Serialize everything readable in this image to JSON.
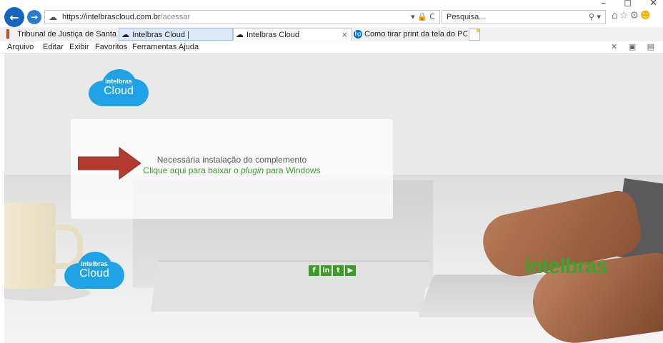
{
  "window": {
    "minimize": "–",
    "maximize": "◻",
    "close": "✕"
  },
  "address_bar": {
    "url_host": "https://intelbrascloud.com.br",
    "url_path": "/acessar",
    "tools": "▾ 🔒 C",
    "search_placeholder": "Pesquisa...",
    "search_icon": "⚲ ▾"
  },
  "tabs": [
    {
      "label": "Tribunal de Justiça de Santa Ca...",
      "icon": "flag-icon"
    },
    {
      "label": "Intelbras Cloud |",
      "icon": "cloud-icon"
    },
    {
      "label": "Intelbras Cloud",
      "icon": "cloud-icon",
      "close": "×",
      "active": true
    },
    {
      "label": "Como tirar print da tela do PC ...",
      "icon": "hp-icon",
      "icon_text": "hp"
    }
  ],
  "menu": [
    "Arquivo",
    "Editar",
    "Exibir",
    "Favoritos",
    "Ferramentas",
    "Ajuda"
  ],
  "menu_right": "✕ ▣ ▤",
  "logo": {
    "line1": "intelbras",
    "line2": "Cloud"
  },
  "plugin_panel": {
    "message": "Necessária instalação do complemento",
    "link_before": "Clique aqui para baixar o ",
    "link_em": "plugin",
    "link_after": " para Windows"
  },
  "social": [
    "f",
    "in",
    "t",
    "▶"
  ],
  "brand": "intelbras",
  "colors": {
    "accent_green": "#3ea22d",
    "cloud_blue": "#1fa2e6",
    "arrow_red": "#b23a2f"
  }
}
